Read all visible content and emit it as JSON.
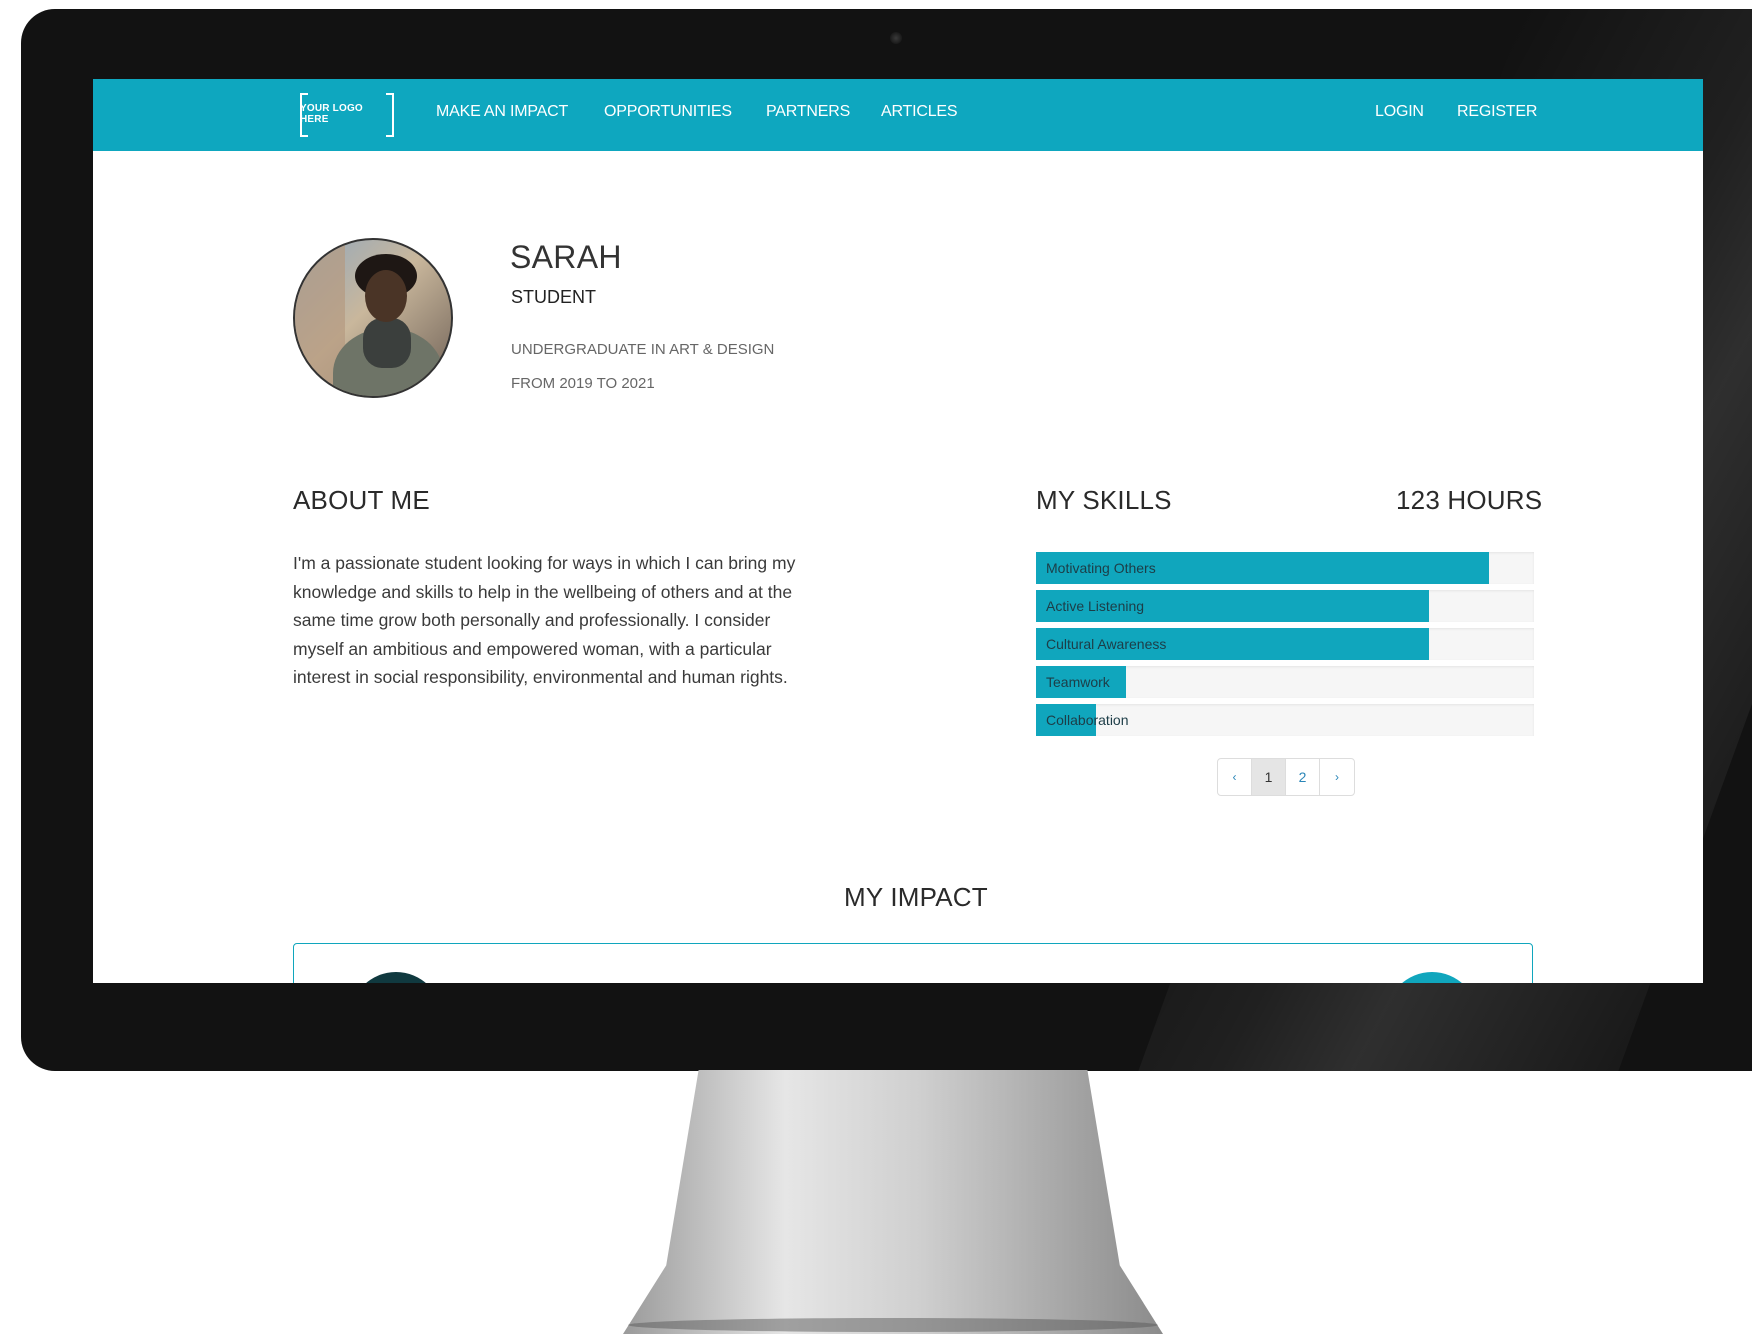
{
  "nav": {
    "logo": "YOUR LOGO HERE",
    "links": [
      "MAKE AN IMPACT",
      "OPPORTUNITIES",
      "PARTNERS",
      "ARTICLES"
    ],
    "login": "LOGIN",
    "register": "REGISTER"
  },
  "profile": {
    "name": "SARAH",
    "role": "STUDENT",
    "education": "UNDERGRADUATE IN ART & DESIGN",
    "dates": "FROM 2019 TO 2021"
  },
  "about": {
    "title": "ABOUT ME",
    "text": "I'm a passionate student looking for ways in which I can bring my knowledge and skills to help in the wellbeing of others and at the same time grow both personally and professionally. I consider myself an ambitious and empowered woman, with a particular interest in social responsibility, environmental and human rights."
  },
  "skills": {
    "title": "MY SKILLS",
    "hours": "123 HOURS",
    "items": [
      {
        "label": "Motivating Others",
        "percent": 91
      },
      {
        "label": "Active Listening",
        "percent": 79
      },
      {
        "label": "Cultural Awareness",
        "percent": 79
      },
      {
        "label": "Teamwork",
        "percent": 18
      },
      {
        "label": "Collaboration",
        "percent": 12
      }
    ]
  },
  "pagination": {
    "prev": "‹",
    "pages": [
      "1",
      "2"
    ],
    "next": "›",
    "current": "1"
  },
  "impact": {
    "title": "MY IMPACT"
  },
  "colors": {
    "accent": "#0ea7bf",
    "skill_fill": "#10a6bd",
    "text_dark": "#2a2a2a"
  },
  "icons": {
    "prev": "chevron-left-icon",
    "next": "chevron-right-icon"
  }
}
